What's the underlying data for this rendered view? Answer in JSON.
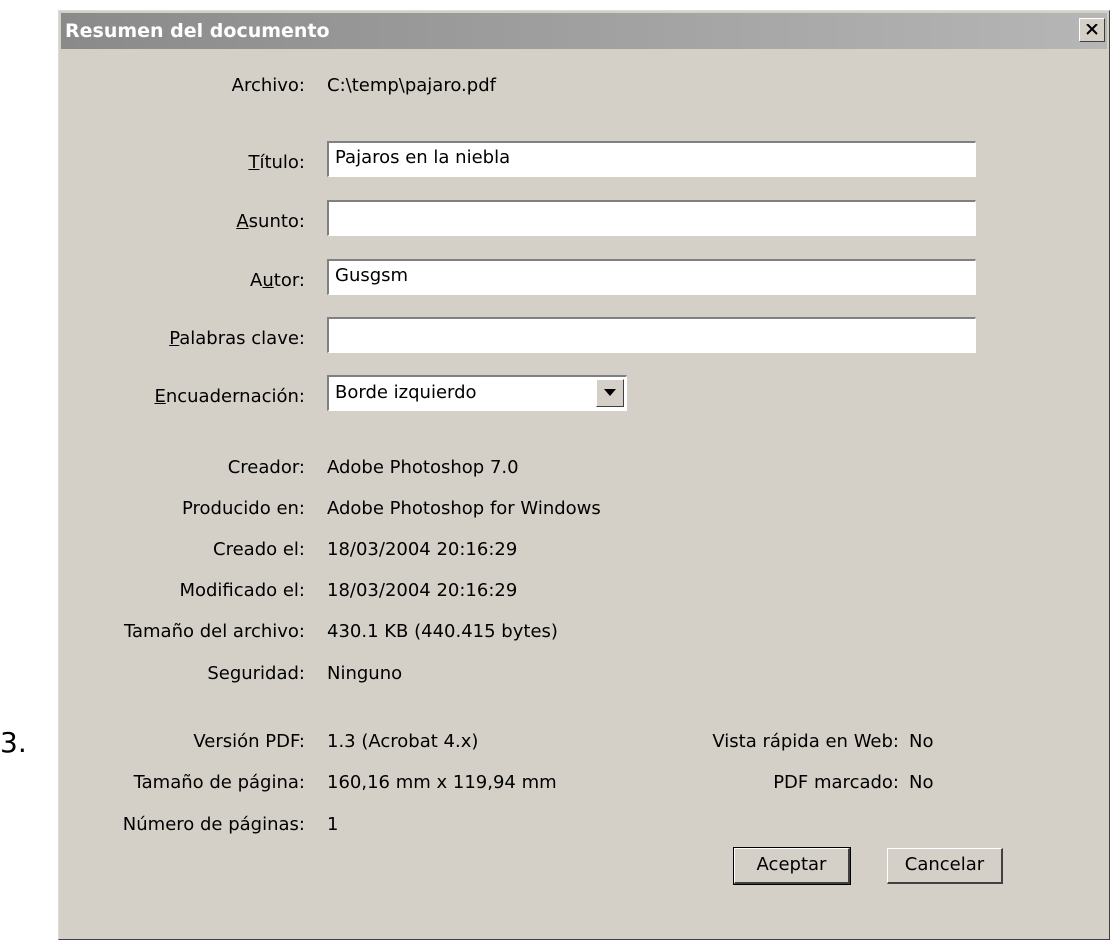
{
  "outer_label": "3.",
  "window": {
    "title": "Resumen del documento"
  },
  "fields": {
    "archivo": {
      "label": "Archivo:",
      "value": "C:\\temp\\pajaro.pdf"
    },
    "titulo": {
      "label_pre": "",
      "label_u": "T",
      "label_post": "ítulo:",
      "value": "Pajaros en la niebla"
    },
    "asunto": {
      "label_pre": "",
      "label_u": "A",
      "label_post": "sunto:",
      "value": ""
    },
    "autor": {
      "label_pre": "A",
      "label_u": "u",
      "label_post": "tor:",
      "value": "Gusgsm"
    },
    "palabras": {
      "label_pre": "",
      "label_u": "P",
      "label_post": "alabras clave:",
      "value": ""
    },
    "encuadernacion": {
      "label_pre": "",
      "label_u": "E",
      "label_post": "ncuadernación:",
      "value": "Borde izquierdo"
    }
  },
  "info": [
    {
      "label": "Creador:",
      "value": "Adobe Photoshop 7.0"
    },
    {
      "label": "Producido en:",
      "value": "Adobe Photoshop for Windows"
    },
    {
      "label": "Creado el:",
      "value": "18/03/2004 20:16:29"
    },
    {
      "label": "Modificado el:",
      "value": "18/03/2004 20:16:29"
    },
    {
      "label": "Tamaño del archivo:",
      "value": "430.1 KB (440.415 bytes)"
    },
    {
      "label": "Seguridad:",
      "value": "Ninguno"
    }
  ],
  "pdf_info": [
    {
      "label": "Versión PDF:",
      "value": "1.3 (Acrobat 4.x)"
    },
    {
      "label": "Tamaño de página:",
      "value": "160,16 mm x 119,94 mm"
    },
    {
      "label": "Número de páginas:",
      "value": "1"
    }
  ],
  "pdf_right": [
    {
      "label": "Vista rápida en Web:",
      "value": "No"
    },
    {
      "label": "PDF marcado:",
      "value": "No"
    }
  ],
  "buttons": {
    "ok": "Aceptar",
    "cancel": "Cancelar"
  }
}
